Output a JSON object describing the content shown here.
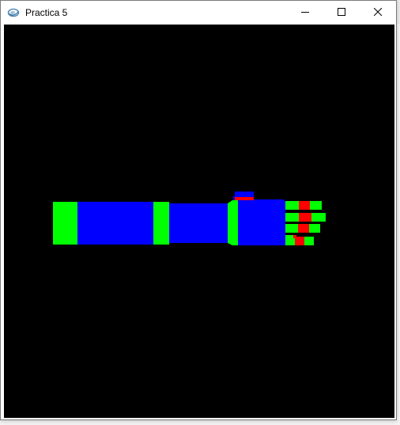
{
  "window": {
    "title": "Practica 5"
  },
  "title_bar": {
    "app_icon": "opengl-window-icon",
    "buttons": [
      {
        "name": "minimize",
        "icon": "minimize-icon"
      },
      {
        "name": "maximize",
        "icon": "maximize-icon"
      },
      {
        "name": "close",
        "icon": "close-icon"
      }
    ]
  },
  "scene": {
    "background": "#000000",
    "colors": {
      "segment": "#0000ff",
      "joint": "#00ff00",
      "finger_joint": "#ff0000"
    },
    "parts": [
      "shoulder-joint",
      "upper-arm",
      "elbow-joint",
      "forearm",
      "wrist-joint",
      "palm",
      "thumb",
      "finger-1",
      "finger-2",
      "finger-3",
      "finger-4"
    ]
  }
}
